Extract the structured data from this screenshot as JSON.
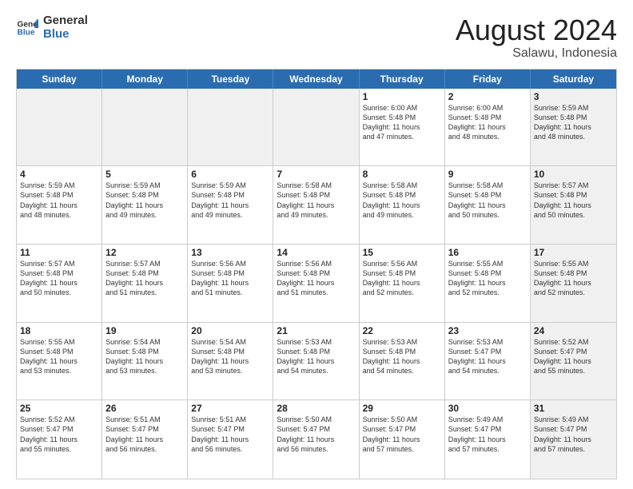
{
  "logo": {
    "line1": "General",
    "line2": "Blue"
  },
  "title": "August 2024",
  "location": "Salawu, Indonesia",
  "header_days": [
    "Sunday",
    "Monday",
    "Tuesday",
    "Wednesday",
    "Thursday",
    "Friday",
    "Saturday"
  ],
  "weeks": [
    [
      {
        "day": "",
        "info": "",
        "shaded": true
      },
      {
        "day": "",
        "info": "",
        "shaded": true
      },
      {
        "day": "",
        "info": "",
        "shaded": true
      },
      {
        "day": "",
        "info": "",
        "shaded": true
      },
      {
        "day": "1",
        "info": "Sunrise: 6:00 AM\nSunset: 5:48 PM\nDaylight: 11 hours\nand 47 minutes.",
        "shaded": false
      },
      {
        "day": "2",
        "info": "Sunrise: 6:00 AM\nSunset: 5:48 PM\nDaylight: 11 hours\nand 48 minutes.",
        "shaded": false
      },
      {
        "day": "3",
        "info": "Sunrise: 5:59 AM\nSunset: 5:48 PM\nDaylight: 11 hours\nand 48 minutes.",
        "shaded": true
      }
    ],
    [
      {
        "day": "4",
        "info": "Sunrise: 5:59 AM\nSunset: 5:48 PM\nDaylight: 11 hours\nand 48 minutes.",
        "shaded": false
      },
      {
        "day": "5",
        "info": "Sunrise: 5:59 AM\nSunset: 5:48 PM\nDaylight: 11 hours\nand 49 minutes.",
        "shaded": false
      },
      {
        "day": "6",
        "info": "Sunrise: 5:59 AM\nSunset: 5:48 PM\nDaylight: 11 hours\nand 49 minutes.",
        "shaded": false
      },
      {
        "day": "7",
        "info": "Sunrise: 5:58 AM\nSunset: 5:48 PM\nDaylight: 11 hours\nand 49 minutes.",
        "shaded": false
      },
      {
        "day": "8",
        "info": "Sunrise: 5:58 AM\nSunset: 5:48 PM\nDaylight: 11 hours\nand 49 minutes.",
        "shaded": false
      },
      {
        "day": "9",
        "info": "Sunrise: 5:58 AM\nSunset: 5:48 PM\nDaylight: 11 hours\nand 50 minutes.",
        "shaded": false
      },
      {
        "day": "10",
        "info": "Sunrise: 5:57 AM\nSunset: 5:48 PM\nDaylight: 11 hours\nand 50 minutes.",
        "shaded": true
      }
    ],
    [
      {
        "day": "11",
        "info": "Sunrise: 5:57 AM\nSunset: 5:48 PM\nDaylight: 11 hours\nand 50 minutes.",
        "shaded": false
      },
      {
        "day": "12",
        "info": "Sunrise: 5:57 AM\nSunset: 5:48 PM\nDaylight: 11 hours\nand 51 minutes.",
        "shaded": false
      },
      {
        "day": "13",
        "info": "Sunrise: 5:56 AM\nSunset: 5:48 PM\nDaylight: 11 hours\nand 51 minutes.",
        "shaded": false
      },
      {
        "day": "14",
        "info": "Sunrise: 5:56 AM\nSunset: 5:48 PM\nDaylight: 11 hours\nand 51 minutes.",
        "shaded": false
      },
      {
        "day": "15",
        "info": "Sunrise: 5:56 AM\nSunset: 5:48 PM\nDaylight: 11 hours\nand 52 minutes.",
        "shaded": false
      },
      {
        "day": "16",
        "info": "Sunrise: 5:55 AM\nSunset: 5:48 PM\nDaylight: 11 hours\nand 52 minutes.",
        "shaded": false
      },
      {
        "day": "17",
        "info": "Sunrise: 5:55 AM\nSunset: 5:48 PM\nDaylight: 11 hours\nand 52 minutes.",
        "shaded": true
      }
    ],
    [
      {
        "day": "18",
        "info": "Sunrise: 5:55 AM\nSunset: 5:48 PM\nDaylight: 11 hours\nand 53 minutes.",
        "shaded": false
      },
      {
        "day": "19",
        "info": "Sunrise: 5:54 AM\nSunset: 5:48 PM\nDaylight: 11 hours\nand 53 minutes.",
        "shaded": false
      },
      {
        "day": "20",
        "info": "Sunrise: 5:54 AM\nSunset: 5:48 PM\nDaylight: 11 hours\nand 53 minutes.",
        "shaded": false
      },
      {
        "day": "21",
        "info": "Sunrise: 5:53 AM\nSunset: 5:48 PM\nDaylight: 11 hours\nand 54 minutes.",
        "shaded": false
      },
      {
        "day": "22",
        "info": "Sunrise: 5:53 AM\nSunset: 5:48 PM\nDaylight: 11 hours\nand 54 minutes.",
        "shaded": false
      },
      {
        "day": "23",
        "info": "Sunrise: 5:53 AM\nSunset: 5:47 PM\nDaylight: 11 hours\nand 54 minutes.",
        "shaded": false
      },
      {
        "day": "24",
        "info": "Sunrise: 5:52 AM\nSunset: 5:47 PM\nDaylight: 11 hours\nand 55 minutes.",
        "shaded": true
      }
    ],
    [
      {
        "day": "25",
        "info": "Sunrise: 5:52 AM\nSunset: 5:47 PM\nDaylight: 11 hours\nand 55 minutes.",
        "shaded": false
      },
      {
        "day": "26",
        "info": "Sunrise: 5:51 AM\nSunset: 5:47 PM\nDaylight: 11 hours\nand 56 minutes.",
        "shaded": false
      },
      {
        "day": "27",
        "info": "Sunrise: 5:51 AM\nSunset: 5:47 PM\nDaylight: 11 hours\nand 56 minutes.",
        "shaded": false
      },
      {
        "day": "28",
        "info": "Sunrise: 5:50 AM\nSunset: 5:47 PM\nDaylight: 11 hours\nand 56 minutes.",
        "shaded": false
      },
      {
        "day": "29",
        "info": "Sunrise: 5:50 AM\nSunset: 5:47 PM\nDaylight: 11 hours\nand 57 minutes.",
        "shaded": false
      },
      {
        "day": "30",
        "info": "Sunrise: 5:49 AM\nSunset: 5:47 PM\nDaylight: 11 hours\nand 57 minutes.",
        "shaded": false
      },
      {
        "day": "31",
        "info": "Sunrise: 5:49 AM\nSunset: 5:47 PM\nDaylight: 11 hours\nand 57 minutes.",
        "shaded": true
      }
    ]
  ]
}
